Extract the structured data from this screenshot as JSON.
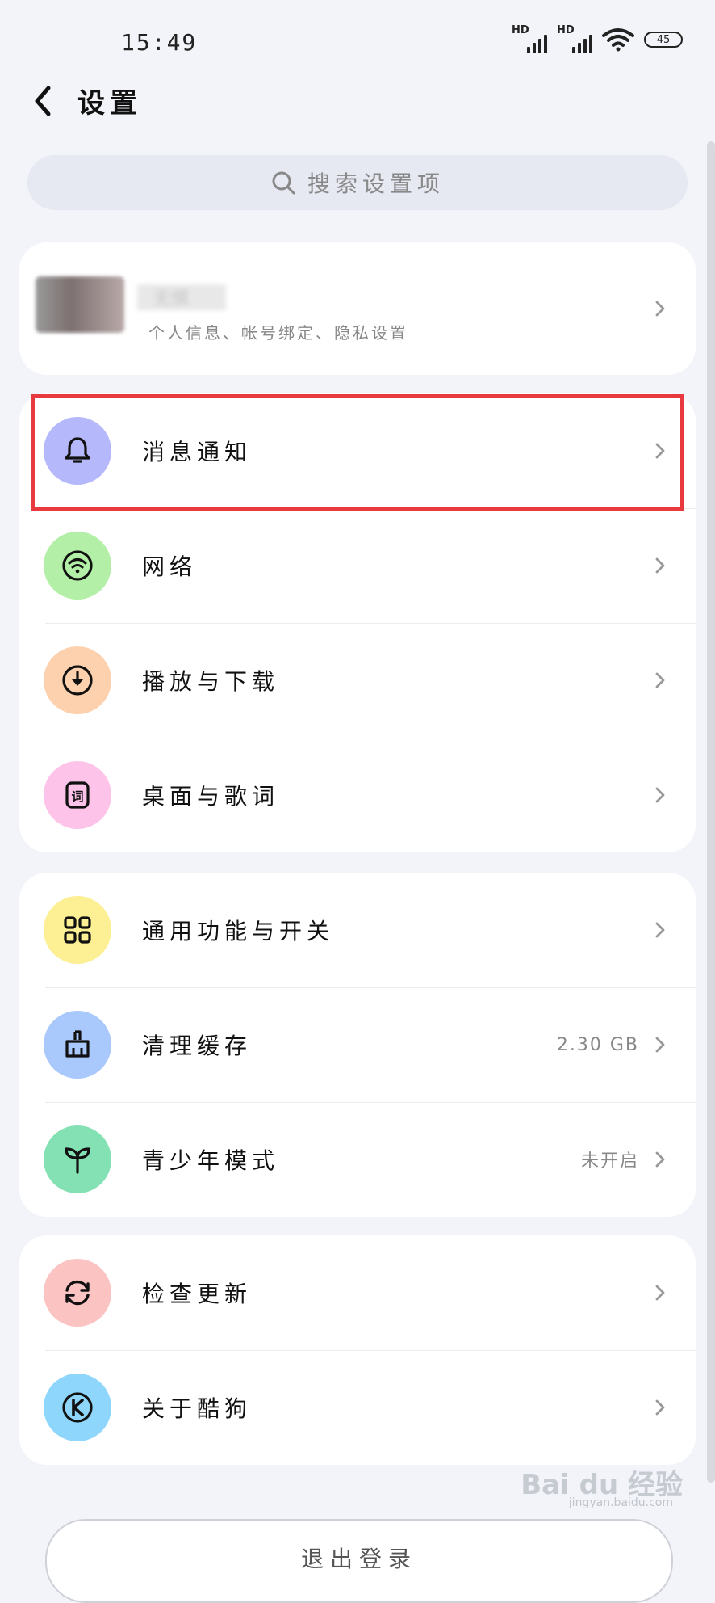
{
  "status_bar": {
    "time": "15:49",
    "signal_label": "HD",
    "battery": "45"
  },
  "header": {
    "title": "设置"
  },
  "search": {
    "placeholder": "搜索设置项"
  },
  "profile": {
    "name": "无惧",
    "subtitle": "个人信息、帐号绑定、隐私设置"
  },
  "groups": [
    {
      "items": [
        {
          "label": "消息通知",
          "icon": "bell-icon",
          "color": "#b5b8fb"
        },
        {
          "label": "网络",
          "icon": "wifi-icon",
          "color": "#b3efa6"
        },
        {
          "label": "播放与下载",
          "icon": "download-icon",
          "color": "#fdd1ae"
        },
        {
          "label": "桌面与歌词",
          "icon": "lyrics-icon",
          "color": "#fdc3e9"
        }
      ]
    },
    {
      "items": [
        {
          "label": "通用功能与开关",
          "icon": "grid-icon",
          "color": "#fcef94"
        },
        {
          "label": "清理缓存",
          "icon": "broom-icon",
          "color": "#a9c8fb",
          "value": "2.30 GB"
        },
        {
          "label": "青少年模式",
          "icon": "sprout-icon",
          "color": "#84e1b4",
          "value": "未开启"
        }
      ]
    },
    {
      "items": [
        {
          "label": "检查更新",
          "icon": "refresh-icon",
          "color": "#fcc3c3"
        },
        {
          "label": "关于酷狗",
          "icon": "kugou-logo-icon",
          "color": "#8ed6fb"
        }
      ]
    }
  ],
  "logout_label": "退出登录",
  "watermark": {
    "brand": "Bai du 经验",
    "url": "jingyan.baidu.com"
  }
}
